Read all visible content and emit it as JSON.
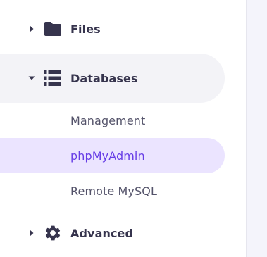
{
  "sidebar": {
    "files": {
      "label": "Files",
      "icon": "folder-icon",
      "expanded": false
    },
    "databases": {
      "label": "Databases",
      "icon": "database-list-icon",
      "expanded": true,
      "children": [
        {
          "label": "Management",
          "active": false
        },
        {
          "label": "phpMyAdmin",
          "active": true
        },
        {
          "label": "Remote MySQL",
          "active": false
        }
      ]
    },
    "advanced": {
      "label": "Advanced",
      "icon": "gear-icon",
      "expanded": false
    }
  },
  "colors": {
    "text_primary": "#36344d",
    "text_secondary": "#54536a",
    "accent": "#673de6",
    "active_bg": "#ebe4ff",
    "hover_bg": "#f3f3f7",
    "icon": "#36344d"
  }
}
